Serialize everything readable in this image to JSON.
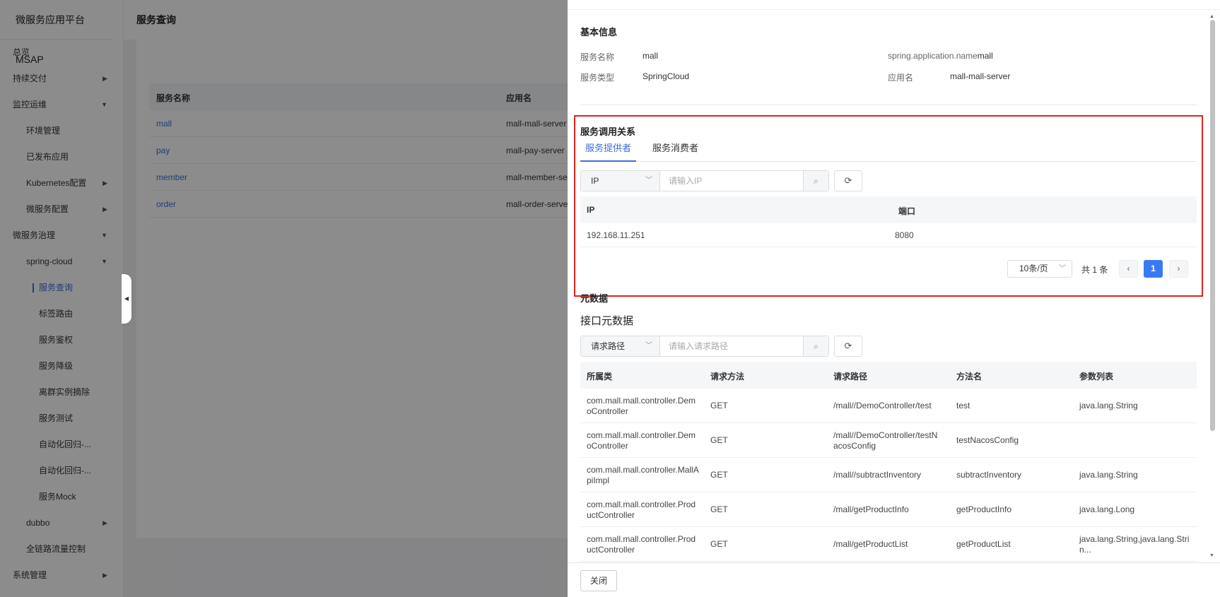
{
  "app": {
    "title": "微服务应用平台MSAP"
  },
  "sidebar": {
    "items": [
      {
        "label": "总览",
        "level": 1,
        "caret": ""
      },
      {
        "label": "持续交付",
        "level": 1,
        "caret": "▶"
      },
      {
        "label": "监控运维",
        "level": 1,
        "caret": "▼"
      },
      {
        "label": "环境管理",
        "level": 2,
        "caret": ""
      },
      {
        "label": "已发布应用",
        "level": 2,
        "caret": ""
      },
      {
        "label": "Kubernetes配置",
        "level": 2,
        "caret": "▶"
      },
      {
        "label": "微服务配置",
        "level": 2,
        "caret": "▶"
      },
      {
        "label": "微服务治理",
        "level": 1,
        "caret": "▼"
      },
      {
        "label": "spring-cloud",
        "level": 2,
        "caret": "▼"
      },
      {
        "label": "服务查询",
        "level": 3,
        "caret": "",
        "active": true
      },
      {
        "label": "标签路由",
        "level": 3,
        "caret": ""
      },
      {
        "label": "服务鉴权",
        "level": 3,
        "caret": ""
      },
      {
        "label": "服务降级",
        "level": 3,
        "caret": ""
      },
      {
        "label": "离群实例摘除",
        "level": 3,
        "caret": ""
      },
      {
        "label": "服务测试",
        "level": 3,
        "caret": ""
      },
      {
        "label": "自动化回归-...",
        "level": 3,
        "caret": ""
      },
      {
        "label": "自动化回归-...",
        "level": 3,
        "caret": ""
      },
      {
        "label": "服务Mock",
        "level": 3,
        "caret": ""
      },
      {
        "label": "dubbo",
        "level": 2,
        "caret": "▶"
      },
      {
        "label": "全链路流量控制",
        "level": 2,
        "caret": ""
      },
      {
        "label": "系统管理",
        "level": 1,
        "caret": "▶"
      }
    ]
  },
  "page": {
    "title": "服务查询",
    "table": {
      "headers": [
        "服务名称",
        "应用名"
      ],
      "rows": [
        [
          "mall",
          "mall-mall-server"
        ],
        [
          "pay",
          "mall-pay-server"
        ],
        [
          "member",
          "mall-member-serv"
        ],
        [
          "order",
          "mall-order-server"
        ]
      ]
    }
  },
  "drawer": {
    "basic": {
      "title": "基本信息",
      "service_name_label": "服务名称",
      "service_name_value": "mall",
      "spring_label": "spring.application.name",
      "spring_value": "mall",
      "service_type_label": "服务类型",
      "service_type_value": "SpringCloud",
      "app_name_label": "应用名",
      "app_name_value": "mall-mall-server"
    },
    "relation": {
      "title": "服务调用关系",
      "tabs": [
        "服务提供者",
        "服务消费者"
      ],
      "filter_select": "IP",
      "filter_placeholder": "请输入IP",
      "headers": [
        "IP",
        "端口"
      ],
      "rows": [
        [
          "192.168.11.251",
          "8080"
        ]
      ],
      "page_size": "10条/页",
      "total": "共 1 条",
      "current_page": "1"
    },
    "meta": {
      "title": "元数据",
      "subtitle": "接口元数据",
      "filter_select": "请求路径",
      "filter_placeholder": "请输入请求路径",
      "headers": [
        "所属类",
        "请求方法",
        "请求路径",
        "方法名",
        "参数列表"
      ],
      "rows": [
        [
          "com.mall.mall.controller.DemoController",
          "GET",
          "/mall//DemoController/test",
          "test",
          "java.lang.String"
        ],
        [
          "com.mall.mall.controller.DemoController",
          "GET",
          "/mall//DemoController/testNacosConfig",
          "testNacosConfig",
          ""
        ],
        [
          "com.mall.mall.controller.MallApiImpl",
          "GET",
          "/mall//subtractInventory",
          "subtractInventory",
          "java.lang.String"
        ],
        [
          "com.mall.mall.controller.ProductController",
          "GET",
          "/mall/getProductInfo",
          "getProductInfo",
          "java.lang.Long"
        ],
        [
          "com.mall.mall.controller.ProductController",
          "GET",
          "/mall/getProductList",
          "getProductList",
          "java.lang.String,java.lang.Strin..."
        ]
      ]
    },
    "close_label": "关闭"
  },
  "colors": {
    "accent": "#3a6fdc",
    "highlight": "#e02020",
    "page_button": "#3a7af0"
  }
}
